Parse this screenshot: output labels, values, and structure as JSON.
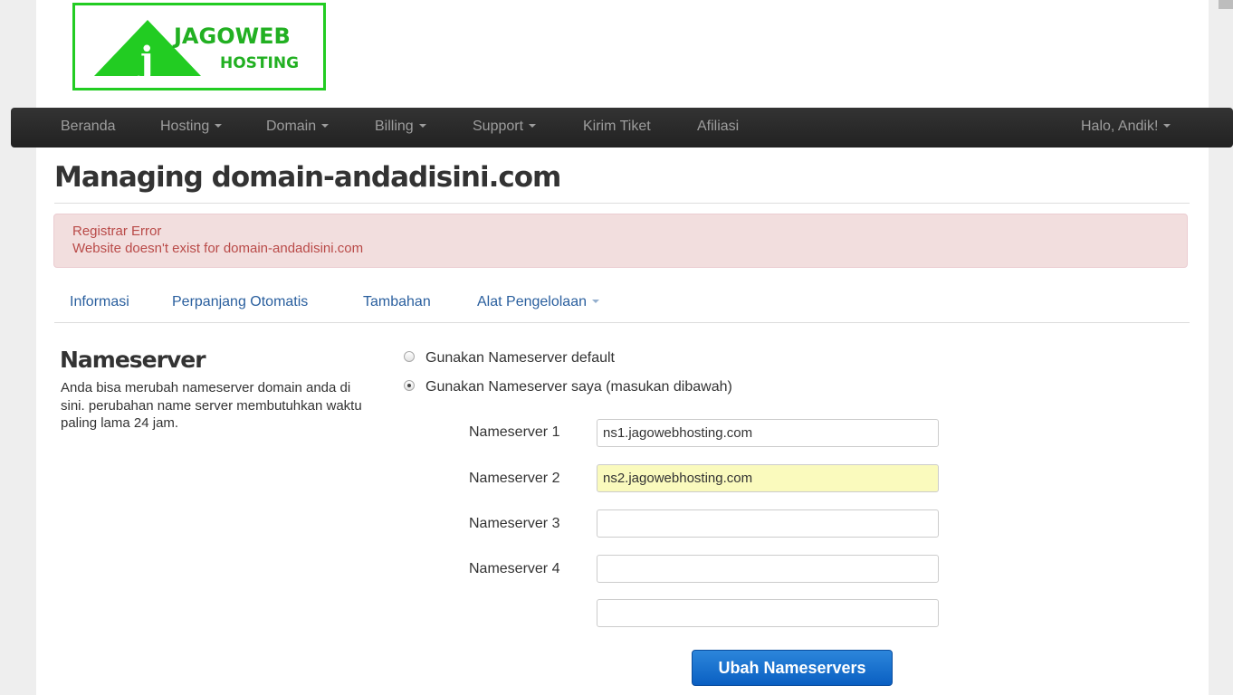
{
  "logo": {
    "line1": "JAGOWEB",
    "line2": "HOSTING",
    "glyph": "j",
    "color": "#22cc22"
  },
  "navbar": {
    "items": [
      {
        "label": "Beranda",
        "dropdown": false
      },
      {
        "label": "Hosting",
        "dropdown": true
      },
      {
        "label": "Domain",
        "dropdown": true
      },
      {
        "label": "Billing",
        "dropdown": true
      },
      {
        "label": "Support",
        "dropdown": true
      },
      {
        "label": "Kirim Tiket",
        "dropdown": false
      },
      {
        "label": "Afiliasi",
        "dropdown": false
      }
    ],
    "user_menu": "Halo, Andik!"
  },
  "page_title": "Managing domain-andadisini.com",
  "alert": {
    "title": "Registrar Error",
    "message": "Website doesn't exist for domain-andadisini.com",
    "color": "#b94a48"
  },
  "tabs": [
    {
      "label": "Informasi"
    },
    {
      "label": "Perpanjang Otomatis"
    },
    {
      "label": "Tambahan"
    },
    {
      "label": "Alat Pengelolaan",
      "dropdown": true
    }
  ],
  "nameserver_section": {
    "title": "Nameserver",
    "description": "Anda bisa merubah nameserver domain anda di sini. perubahan name server membutuhkan waktu paling lama 24 jam.",
    "options": [
      {
        "label": "Gunakan Nameserver default",
        "checked": false
      },
      {
        "label": "Gunakan Nameserver saya (masukan dibawah)",
        "checked": true
      }
    ],
    "fields": [
      {
        "label": "Nameserver 1",
        "value": "ns1.jagowebhosting.com",
        "placeholder": ""
      },
      {
        "label": "Nameserver 2",
        "value": "ns2.jagowebhosting.com",
        "placeholder": ""
      },
      {
        "label": "Nameserver 3",
        "value": "",
        "placeholder": ""
      },
      {
        "label": "Nameserver 4",
        "value": "",
        "placeholder": ""
      },
      {
        "label": "",
        "value": "",
        "placeholder": ""
      }
    ],
    "submit_label": "Ubah Nameservers",
    "submit_color": "#0a5fc2"
  }
}
